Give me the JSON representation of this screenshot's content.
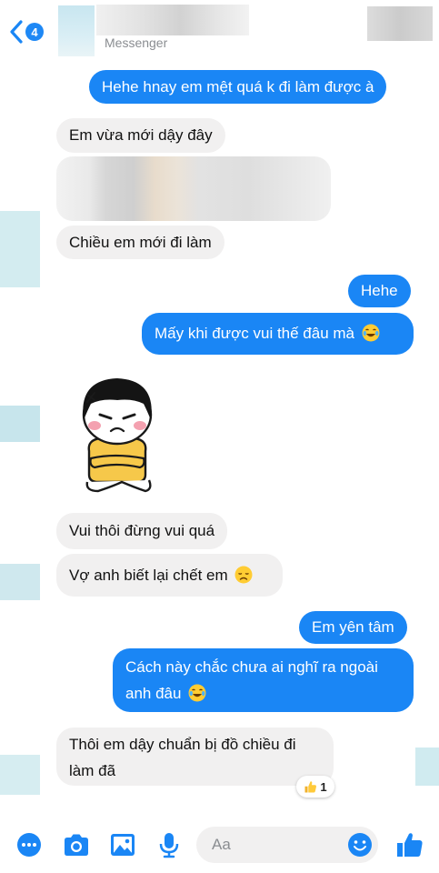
{
  "header": {
    "back_badge": "4",
    "subtitle": "Messenger"
  },
  "messages": {
    "m1": "Hehe hnay em mệt quá k đi làm được à",
    "m2": "Em vừa mới dậy đây",
    "m4": "Chiều em mới đi làm",
    "m5": "Hehe",
    "m6": "Mấy khi được vui thế đâu mà",
    "m8": "Vui thôi đừng vui quá",
    "m9": "Vợ anh biết lại chết em",
    "m10": "Em yên tâm",
    "m11a": "Cách này chắc chưa ai nghĩ ra ngoài",
    "m11b": "anh đâu",
    "m12a": "Thôi em dậy chuẩn bị đồ chiều đi",
    "m12b": "làm đã"
  },
  "reaction": {
    "count": "1"
  },
  "composer": {
    "placeholder": "Aa"
  },
  "colors": {
    "accent": "#1a86f5",
    "incoming": "#f1f0f0"
  }
}
